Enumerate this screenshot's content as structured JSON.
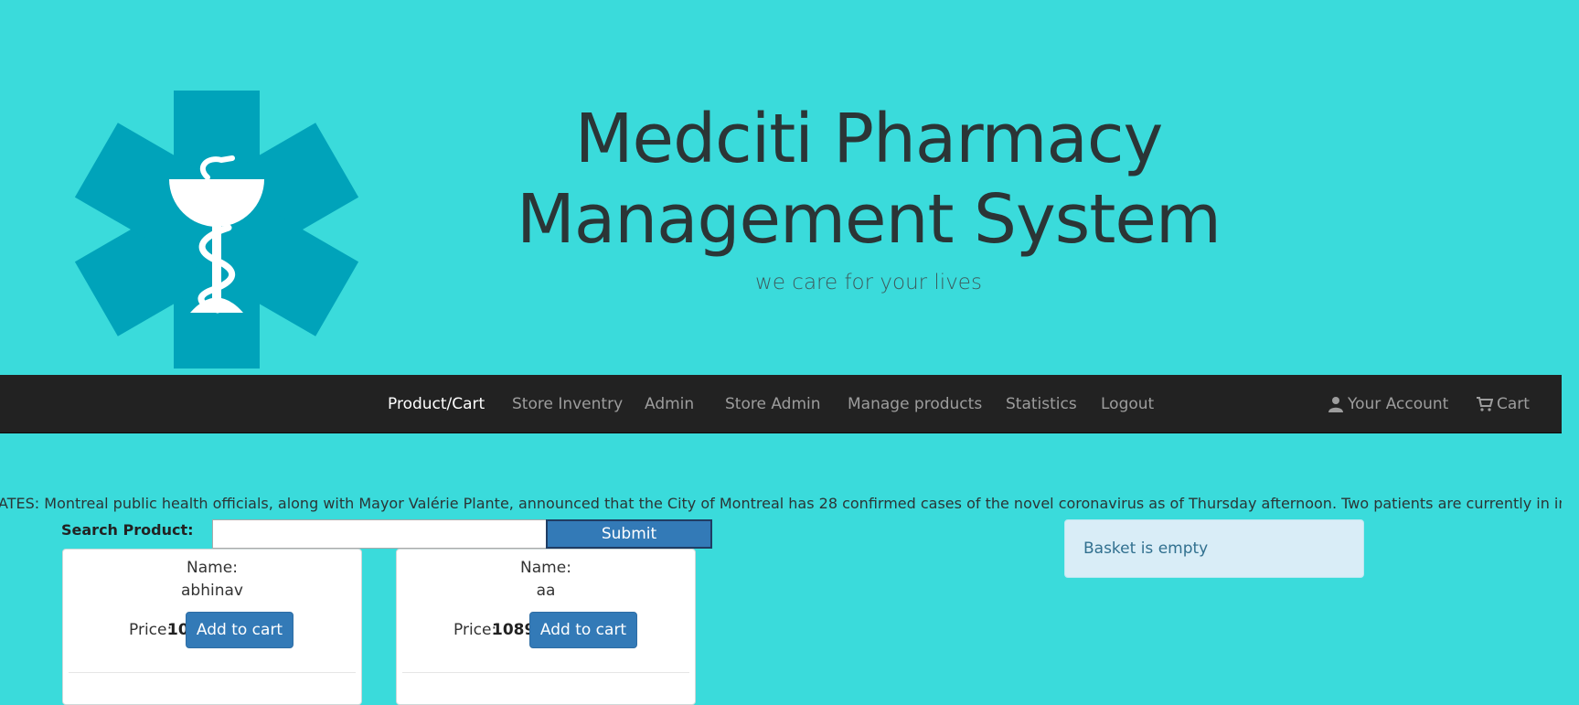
{
  "header": {
    "title_line1": "Medciti Pharmacy",
    "title_line2": "Management System",
    "tagline": "we care for your lives",
    "logo_icon": "star-of-life-bowl-of-hygieia-icon"
  },
  "navbar": {
    "items": [
      {
        "label": "Product/Cart",
        "active": true
      },
      {
        "label": "Store Inventry",
        "active": false
      },
      {
        "label": "Admin",
        "active": false
      },
      {
        "label": "Store Admin",
        "active": false
      },
      {
        "label": "Manage products",
        "active": false
      },
      {
        "label": "Statistics",
        "active": false
      },
      {
        "label": "Logout",
        "active": false
      }
    ],
    "account": {
      "label": "Your Account",
      "icon": "user-icon"
    },
    "cart": {
      "label": "Cart",
      "icon": "shopping-cart-icon"
    }
  },
  "ticker": {
    "text": "DATES: Montreal public health officials, along with Mayor Valérie Plante, announced that the City of Montreal has 28 confirmed cases of the novel coronavirus as of Thursday afternoon. Two patients are currently in intensive c"
  },
  "search": {
    "label": "Search Product:",
    "value": "",
    "placeholder": "",
    "submit_label": "Submit"
  },
  "products": [
    {
      "name_label": "Name:",
      "name": "abhinav",
      "price_label": "Price:",
      "price": "10",
      "button_label": "Add to cart"
    },
    {
      "name_label": "Name:",
      "name": "aa",
      "price_label": "Price:",
      "price": "1089",
      "button_label": "Add to cart"
    }
  ],
  "basket": {
    "message": "Basket is empty"
  },
  "colors": {
    "page_background": "#3adbdb",
    "logo": "#00a3ba",
    "navbar": "#222222",
    "nav_text": "#9d9d9d",
    "nav_active": "#ffffff",
    "primary_button": "#337ab7",
    "basket_background": "#d9edf7",
    "basket_text": "#31708f",
    "title_text": "#2b3536"
  }
}
